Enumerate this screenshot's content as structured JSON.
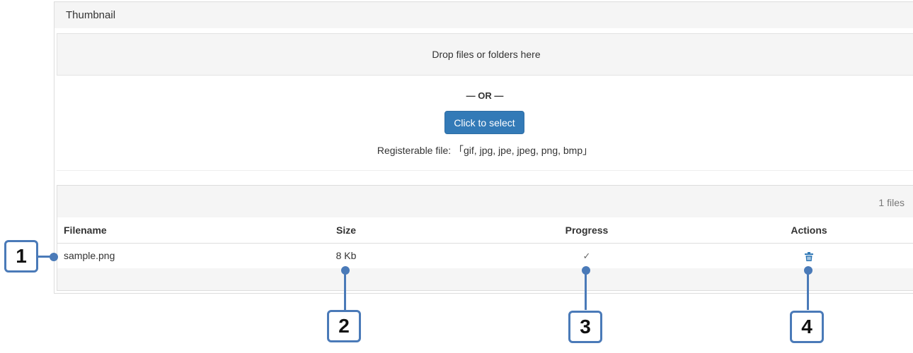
{
  "panel": {
    "title": "Thumbnail"
  },
  "dropzone": {
    "text": "Drop files or folders here"
  },
  "upload": {
    "or_text": "— OR —",
    "select_button": "Click to select",
    "registerable_text": "Registerable file: 「gif, jpg, jpe, jpeg, png, bmp」"
  },
  "files": {
    "count_text": "1 files",
    "columns": {
      "filename": "Filename",
      "size": "Size",
      "progress": "Progress",
      "actions": "Actions"
    },
    "rows": [
      {
        "filename": "sample.png",
        "size": "8 Kb",
        "progress_icon": "check-icon",
        "action_icon": "trash-icon"
      }
    ]
  },
  "annotations": [
    "1",
    "2",
    "3",
    "4"
  ],
  "colors": {
    "primary_button": "#337ab7",
    "annotation": "#4a7ab8",
    "panel_bg": "#f5f5f5"
  }
}
